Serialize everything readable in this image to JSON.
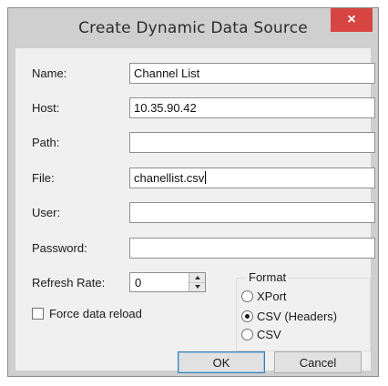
{
  "dialog": {
    "title": "Create Dynamic Data Source",
    "close_glyph": "×"
  },
  "fields": [
    {
      "label": "Name:",
      "value": "Channel List"
    },
    {
      "label": "Host:",
      "value": "10.35.90.42"
    },
    {
      "label": "Path:",
      "value": ""
    },
    {
      "label": "File:",
      "value": "chanellist.csv"
    },
    {
      "label": "User:",
      "value": ""
    },
    {
      "label": "Password:",
      "value": ""
    }
  ],
  "refresh": {
    "label": "Refresh Rate:",
    "value": "0"
  },
  "force_reload": {
    "label": "Force data reload",
    "checked": false
  },
  "format": {
    "title": "Format",
    "options": [
      {
        "label": "XPort",
        "selected": false
      },
      {
        "label": "CSV (Headers)",
        "selected": true
      },
      {
        "label": "CSV",
        "selected": false
      }
    ]
  },
  "buttons": {
    "ok_label": "OK",
    "cancel_label": "Cancel"
  },
  "colors": {
    "close_button": "#d64541",
    "frame": "#cfcfcf",
    "client": "#f0f0f0"
  }
}
